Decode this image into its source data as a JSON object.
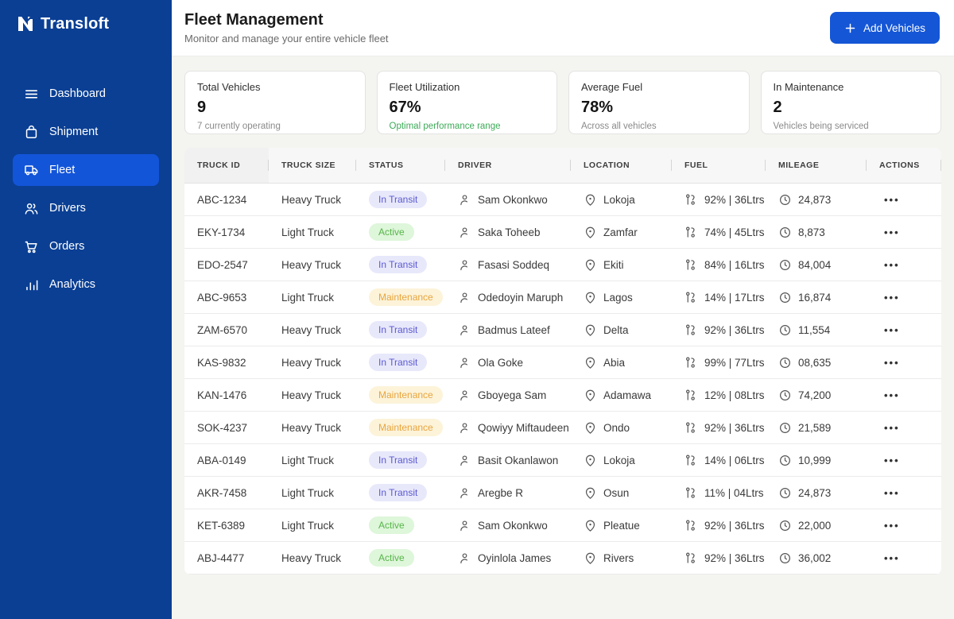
{
  "brand": {
    "name": "Transloft",
    "logo_icon": "transloft-logo-icon"
  },
  "sidebar": {
    "items": [
      {
        "id": "dashboard",
        "label": "Dashboard",
        "icon": "menu-icon",
        "active": false
      },
      {
        "id": "shipment",
        "label": "Shipment",
        "icon": "shipment-bag-icon",
        "active": false
      },
      {
        "id": "fleet",
        "label": "Fleet",
        "icon": "truck-icon",
        "active": true
      },
      {
        "id": "drivers",
        "label": "Drivers",
        "icon": "users-icon",
        "active": false
      },
      {
        "id": "orders",
        "label": "Orders",
        "icon": "cart-icon",
        "active": false
      },
      {
        "id": "analytics",
        "label": "Analytics",
        "icon": "analytics-bars-icon",
        "active": false
      }
    ]
  },
  "header": {
    "title": "Fleet Management",
    "subtitle": "Monitor and manage your entire vehicle fleet",
    "add_button": "Add Vehicles"
  },
  "stats": [
    {
      "label": "Total Vehicles",
      "value": "9",
      "note": "7 currently operating",
      "note_color": "#8a8a8a"
    },
    {
      "label": "Fleet Utilization",
      "value": "67%",
      "note": "Optimal performance range",
      "note_color": "#3cab57"
    },
    {
      "label": "Average Fuel",
      "value": "78%",
      "note": "Across all vehicles",
      "note_color": "#8a8a8a"
    },
    {
      "label": "In Maintenance",
      "value": "2",
      "note": "Vehicles being serviced",
      "note_color": "#8a8a8a"
    }
  ],
  "table": {
    "columns": [
      "Truck ID",
      "Truck Size",
      "Status",
      "Driver",
      "Location",
      "Fuel",
      "Mileage",
      "Actions"
    ],
    "status_styles": {
      "In Transit": {
        "bg": "#e8e8fb",
        "fg": "#5a5ad1"
      },
      "Active": {
        "bg": "#def6da",
        "fg": "#58b54b"
      },
      "Maintenance": {
        "bg": "#fcf3d9",
        "fg": "#e8a53e"
      }
    },
    "rows": [
      {
        "truck_id": "ABC-1234",
        "truck_size": "Heavy Truck",
        "status": "In Transit",
        "driver": "Sam Okonkwo",
        "location": "Lokoja",
        "fuel": "92% | 36Ltrs",
        "mileage": "24,873"
      },
      {
        "truck_id": "EKY-1734",
        "truck_size": "Light Truck",
        "status": "Active",
        "driver": "Saka Toheeb",
        "location": "Zamfar",
        "fuel": "74% | 45Ltrs",
        "mileage": "8,873"
      },
      {
        "truck_id": "EDO-2547",
        "truck_size": "Heavy Truck",
        "status": "In Transit",
        "driver": "Fasasi Soddeq",
        "location": "Ekiti",
        "fuel": "84% | 16Ltrs",
        "mileage": "84,004"
      },
      {
        "truck_id": "ABC-9653",
        "truck_size": "Light Truck",
        "status": "Maintenance",
        "driver": "Odedoyin Maruph",
        "location": "Lagos",
        "fuel": "14% | 17Ltrs",
        "mileage": "16,874"
      },
      {
        "truck_id": "ZAM-6570",
        "truck_size": "Heavy Truck",
        "status": "In Transit",
        "driver": "Badmus Lateef",
        "location": "Delta",
        "fuel": "92% | 36Ltrs",
        "mileage": "11,554"
      },
      {
        "truck_id": "KAS-9832",
        "truck_size": "Heavy Truck",
        "status": "In Transit",
        "driver": "Ola Goke",
        "location": "Abia",
        "fuel": "99% | 77Ltrs",
        "mileage": "08,635"
      },
      {
        "truck_id": "KAN-1476",
        "truck_size": "Heavy Truck",
        "status": "Maintenance",
        "driver": "Gboyega Sam",
        "location": "Adamawa",
        "fuel": "12% | 08Ltrs",
        "mileage": "74,200"
      },
      {
        "truck_id": "SOK-4237",
        "truck_size": "Heavy Truck",
        "status": "Maintenance",
        "driver": "Qowiyy Miftaudeen",
        "location": "Ondo",
        "fuel": "92% | 36Ltrs",
        "mileage": "21,589"
      },
      {
        "truck_id": "ABA-0149",
        "truck_size": "Light Truck",
        "status": "In Transit",
        "driver": "Basit Okanlawon",
        "location": "Lokoja",
        "fuel": "14% | 06Ltrs",
        "mileage": "10,999"
      },
      {
        "truck_id": "AKR-7458",
        "truck_size": "Light Truck",
        "status": "In Transit",
        "driver": "Aregbe R",
        "location": "Osun",
        "fuel": "11% | 04Ltrs",
        "mileage": "24,873"
      },
      {
        "truck_id": "KET-6389",
        "truck_size": "Light Truck",
        "status": "Active",
        "driver": "Sam Okonkwo",
        "location": "Pleatue",
        "fuel": "92% | 36Ltrs",
        "mileage": "22,000"
      },
      {
        "truck_id": "ABJ-4477",
        "truck_size": "Heavy Truck",
        "status": "Active",
        "driver": "Oyinlola James",
        "location": "Rivers",
        "fuel": "92% | 36Ltrs",
        "mileage": "36,002"
      }
    ]
  },
  "colors": {
    "sidebar_bg": "#0a3f94",
    "sidebar_active": "#1355d9",
    "accent_button": "#1456d6",
    "page_bg": "#f4f5f0",
    "utilization_note_green": "#3cab57"
  }
}
